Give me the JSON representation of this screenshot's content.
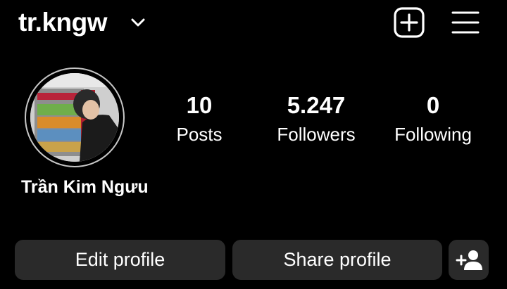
{
  "header": {
    "username": "tr.kngw",
    "account_switcher_icon": "chevron-down-icon",
    "create_icon": "plus-square-icon",
    "menu_icon": "hamburger-menu-icon"
  },
  "profile": {
    "display_name": "Trần Kim Ngưu",
    "avatar_icon": "profile-photo"
  },
  "stats": [
    {
      "value": "10",
      "label": "Posts"
    },
    {
      "value": "5.247",
      "label": "Followers"
    },
    {
      "value": "0",
      "label": "Following"
    }
  ],
  "actions": {
    "edit_profile_label": "Edit profile",
    "share_profile_label": "Share profile",
    "add_user_icon": "add-user-icon"
  },
  "colors": {
    "background": "#000000",
    "text": "#ffffff",
    "button_bg": "#2a2a2a",
    "avatar_ring": "#c7c7c7"
  }
}
